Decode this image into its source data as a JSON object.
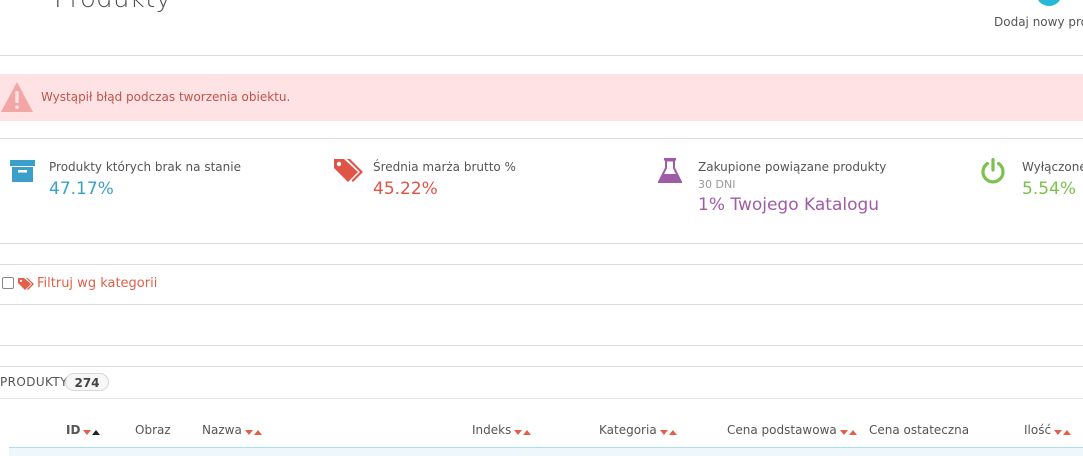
{
  "header": {
    "title": "Produkty",
    "add_new_label": "Dodaj nowy pro"
  },
  "alert": {
    "message": "Wystąpił błąd podczas tworzenia obiektu."
  },
  "kpis": [
    {
      "label": "Produkty których brak na stanie",
      "value": "47.17%",
      "color": "#3aa0c9",
      "icon": "box-icon"
    },
    {
      "label": "Średnia marża brutto %",
      "value": "45.22%",
      "color": "#e05447",
      "icon": "tags-icon"
    },
    {
      "label": "Zakupione powiązane produkty",
      "sub": "30 DNI",
      "value": "1% Twojego Katalogu",
      "color": "#a05ba7",
      "icon": "flask-icon"
    },
    {
      "label": "Wyłączone",
      "value": "5.54%",
      "color": "#7cc04e",
      "icon": "power-icon"
    }
  ],
  "filter": {
    "label": "Filtruj wg kategorii"
  },
  "products": {
    "title": "PRODUKTY",
    "count": "274"
  },
  "table": {
    "columns": [
      {
        "label": "ID"
      },
      {
        "label": "Obraz"
      },
      {
        "label": "Nazwa"
      },
      {
        "label": "Indeks"
      },
      {
        "label": "Kategoria"
      },
      {
        "label": "Cena podstawowa"
      },
      {
        "label": "Cena ostateczna"
      },
      {
        "label": "Ilość"
      }
    ]
  }
}
